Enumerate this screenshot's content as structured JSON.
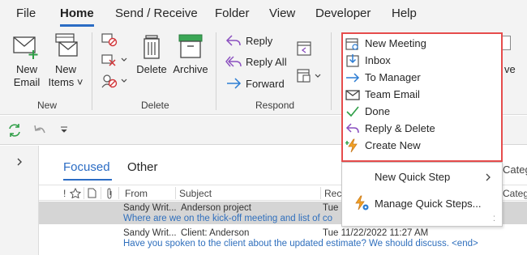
{
  "menu": {
    "tabs": [
      "File",
      "Home",
      "Send / Receive",
      "Folder",
      "View",
      "Developer",
      "Help"
    ],
    "active": "Home"
  },
  "ribbon": {
    "new_group": {
      "label": "New",
      "new_email_line1": "New",
      "new_email_line2": "Email",
      "new_items_line1": "New",
      "new_items_line2": "Items ˅"
    },
    "delete_group": {
      "label": "Delete",
      "delete": "Delete",
      "archive": "Archive"
    },
    "respond_group": {
      "label": "Respond",
      "reply": "Reply",
      "reply_all": "Reply All",
      "forward": "Forward"
    },
    "partial_right": "ve"
  },
  "quick_steps": {
    "items": [
      {
        "label": "New Meeting",
        "icon": "calendar-icon"
      },
      {
        "label": "Inbox",
        "icon": "inbox-arrow-icon"
      },
      {
        "label": "To Manager",
        "icon": "arrow-right-icon"
      },
      {
        "label": "Team Email",
        "icon": "envelope-icon"
      },
      {
        "label": "Done",
        "icon": "checkmark-icon"
      },
      {
        "label": "Reply & Delete",
        "icon": "reply-icon"
      },
      {
        "label": "Create New",
        "icon": "lightning-icon"
      }
    ],
    "menu": {
      "new_quick_step": "New Quick Step",
      "manage_quick_steps": "Manage Quick Steps..."
    }
  },
  "mail": {
    "tabs": {
      "focused": "Focused",
      "other": "Other"
    },
    "columns": {
      "from": "From",
      "subject": "Subject",
      "received": "Rece",
      "categories": "Catego",
      "categ_partial": "Categ"
    },
    "rows": [
      {
        "from": "Sandy Writ...",
        "subject": "Anderson project",
        "date": "Tue",
        "preview": "Where are we on the kick-off meeting and list of co"
      },
      {
        "from": "Sandy Writ...",
        "subject": "Client: Anderson",
        "date": "Tue 11/22/2022 11:27 AM",
        "preview": "Have you spoken to the client about the updated estimate? We should discuss.  <end>"
      }
    ]
  },
  "colors": {
    "accent": "#2b6cc4",
    "highlight_border": "#e64c4c",
    "ribbon_bg": "#f3f3f3"
  }
}
